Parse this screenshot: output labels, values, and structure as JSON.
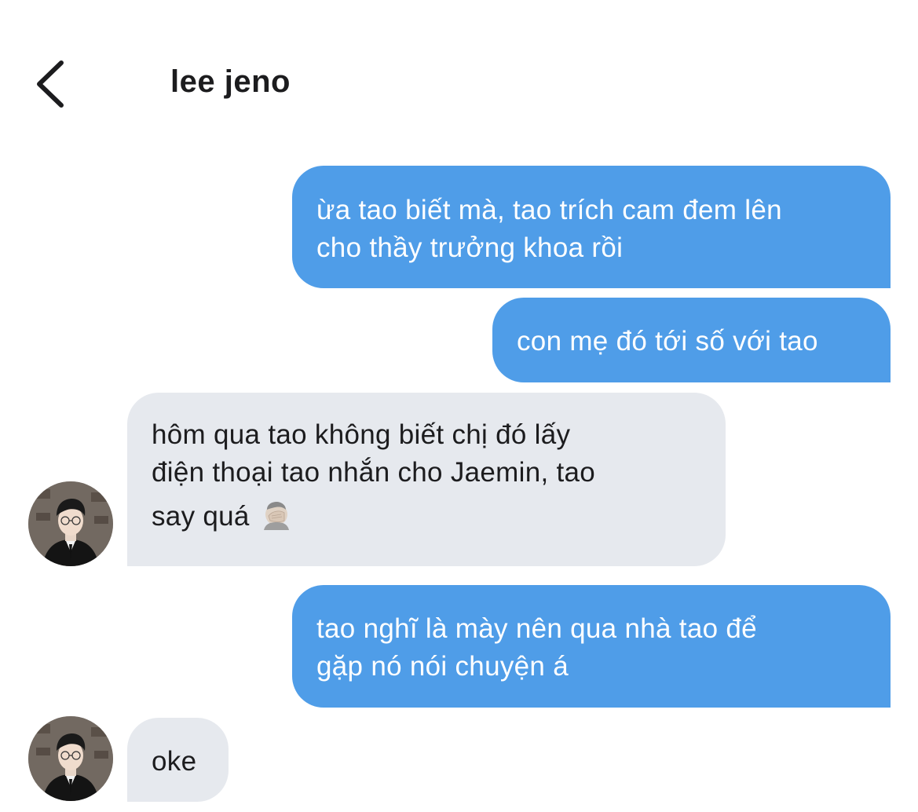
{
  "header": {
    "back_icon": "chevron-left-icon",
    "title": "lee jeno"
  },
  "messages": [
    {
      "direction": "outgoing",
      "lines": [
        "ừa tao biết mà, tao trích cam đem lên",
        "cho thầy trưởng khoa rồi"
      ]
    },
    {
      "direction": "outgoing",
      "lines": [
        "con mẹ đó tới số với tao"
      ]
    },
    {
      "direction": "incoming",
      "lines": [
        "hôm qua tao không biết chị đó lấy",
        "điện thoại tao nhắn cho Jaemin, tao",
        "say quá"
      ],
      "emoji": "face-palm-icon"
    },
    {
      "direction": "outgoing",
      "lines": [
        "tao nghĩ là mày nên qua nhà tao để",
        "gặp nó nói chuyện á"
      ]
    },
    {
      "direction": "incoming",
      "lines": [
        "oke"
      ]
    }
  ],
  "colors": {
    "outgoing_bubble": "#4f9de8",
    "incoming_bubble": "#e6e9ee",
    "outgoing_text": "#ffffff",
    "incoming_text": "#1c1c1e"
  }
}
